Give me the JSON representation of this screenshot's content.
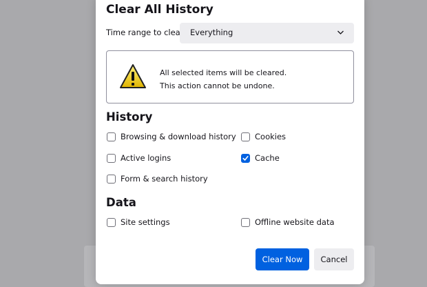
{
  "dialog": {
    "title": "Clear All History"
  },
  "time_range": {
    "label": "Time range to clear:",
    "selected": "Everything"
  },
  "warning": {
    "line1": "All selected items will be cleared.",
    "line2": "This action cannot be undone."
  },
  "history_section": {
    "heading": "History",
    "items": [
      {
        "label": "Browsing & download history",
        "checked": false
      },
      {
        "label": "Cookies",
        "checked": false
      },
      {
        "label": "Active logins",
        "checked": false
      },
      {
        "label": "Cache",
        "checked": true
      },
      {
        "label": "Form & search history",
        "checked": false
      }
    ]
  },
  "data_section": {
    "heading": "Data",
    "items": [
      {
        "label": "Site settings",
        "checked": false
      },
      {
        "label": "Offline website data",
        "checked": false
      }
    ]
  },
  "buttons": {
    "clear_now": "Clear Now",
    "cancel": "Cancel"
  },
  "colors": {
    "accent": "#0061e0",
    "backdrop": "#a9a9ac",
    "warning_yellow": "#f2d000"
  },
  "icons": {
    "warning": "warning-triangle-icon",
    "dropdown": "chevron-down-icon",
    "checkmark": "checkmark-icon"
  }
}
